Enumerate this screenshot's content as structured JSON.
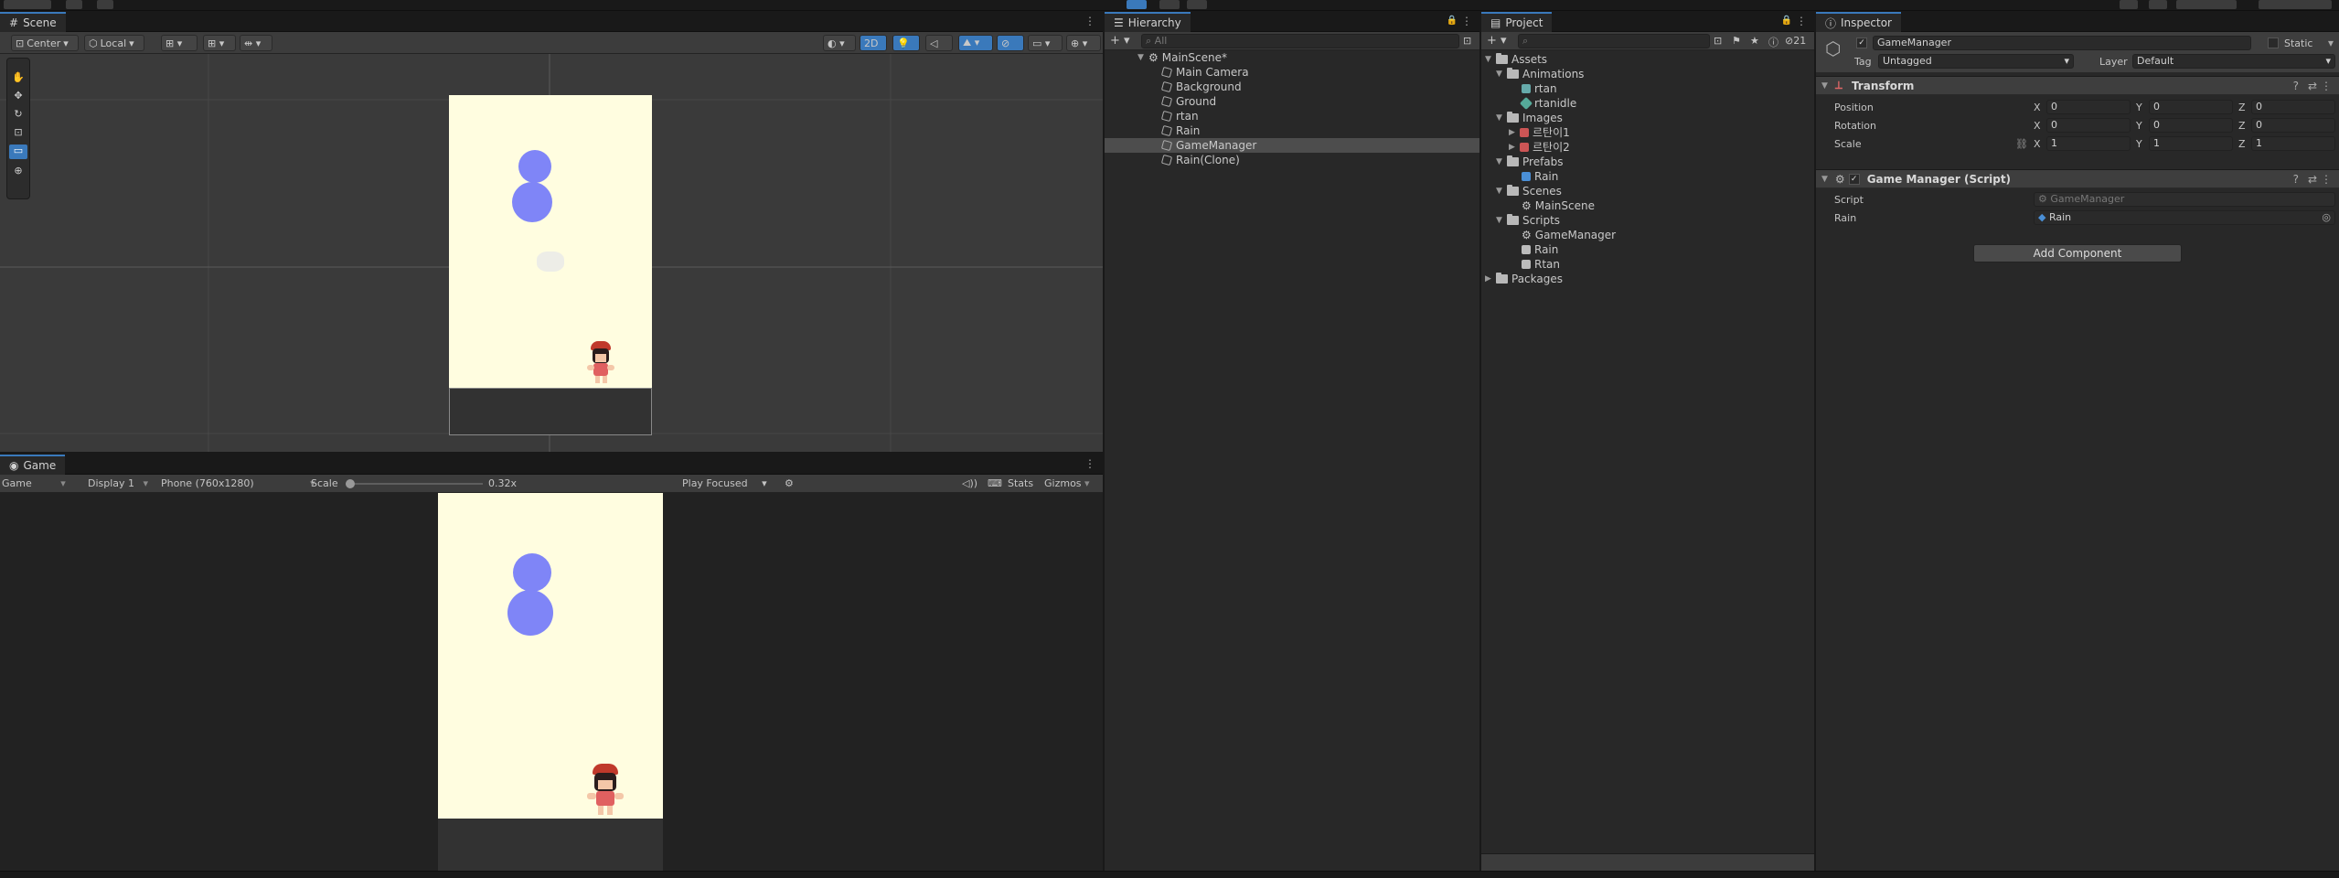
{
  "colors": {
    "accent": "#3a79bb",
    "scene_bg": "#3a3a3a",
    "canvas": "#fffde0",
    "ball": "#7f85f7",
    "ground": "#323232"
  },
  "scene": {
    "tab": "Scene",
    "pivot": "Center",
    "space": "Local",
    "mode_2d": "2D"
  },
  "game": {
    "tab": "Game",
    "view": "Game",
    "display": "Display 1",
    "resolution": "Phone (760x1280)",
    "scale_label": "Scale",
    "scale_value": "0.32x",
    "play_mode": "Play Focused",
    "stats": "Stats",
    "gizmos": "Gizmos"
  },
  "hierarchy": {
    "tab": "Hierarchy",
    "search_placeholder": "All",
    "scene": "MainScene*",
    "items": [
      {
        "label": "Main Camera"
      },
      {
        "label": "Background"
      },
      {
        "label": "Ground"
      },
      {
        "label": "rtan"
      },
      {
        "label": "Rain"
      },
      {
        "label": "GameManager"
      },
      {
        "label": "Rain(Clone)"
      }
    ]
  },
  "project": {
    "tab": "Project",
    "hidden_count": "21",
    "tree": [
      {
        "label": "Assets"
      },
      {
        "label": "Animations"
      },
      {
        "label": "rtan"
      },
      {
        "label": "rtanidle"
      },
      {
        "label": "Images"
      },
      {
        "label": "르탄이1"
      },
      {
        "label": "르탄이2"
      },
      {
        "label": "Prefabs"
      },
      {
        "label": "Rain"
      },
      {
        "label": "Scenes"
      },
      {
        "label": "MainScene"
      },
      {
        "label": "Scripts"
      },
      {
        "label": "GameManager"
      },
      {
        "label": "Rain"
      },
      {
        "label": "Rtan"
      },
      {
        "label": "Packages"
      }
    ]
  },
  "inspector": {
    "tab": "Inspector",
    "object_name": "GameManager",
    "static_label": "Static",
    "tag_label": "Tag",
    "tag_value": "Untagged",
    "layer_label": "Layer",
    "layer_value": "Default",
    "transform": {
      "title": "Transform",
      "position_label": "Position",
      "rotation_label": "Rotation",
      "scale_label": "Scale",
      "x": "X",
      "y": "Y",
      "z": "Z",
      "pos": [
        "0",
        "0",
        "0"
      ],
      "rot": [
        "0",
        "0",
        "0"
      ],
      "scl": [
        "1",
        "1",
        "1"
      ]
    },
    "script_comp": {
      "title": "Game Manager (Script)",
      "script_label": "Script",
      "script_value": "GameManager",
      "rain_label": "Rain",
      "rain_value": "Rain"
    },
    "add_component": "Add Component"
  }
}
